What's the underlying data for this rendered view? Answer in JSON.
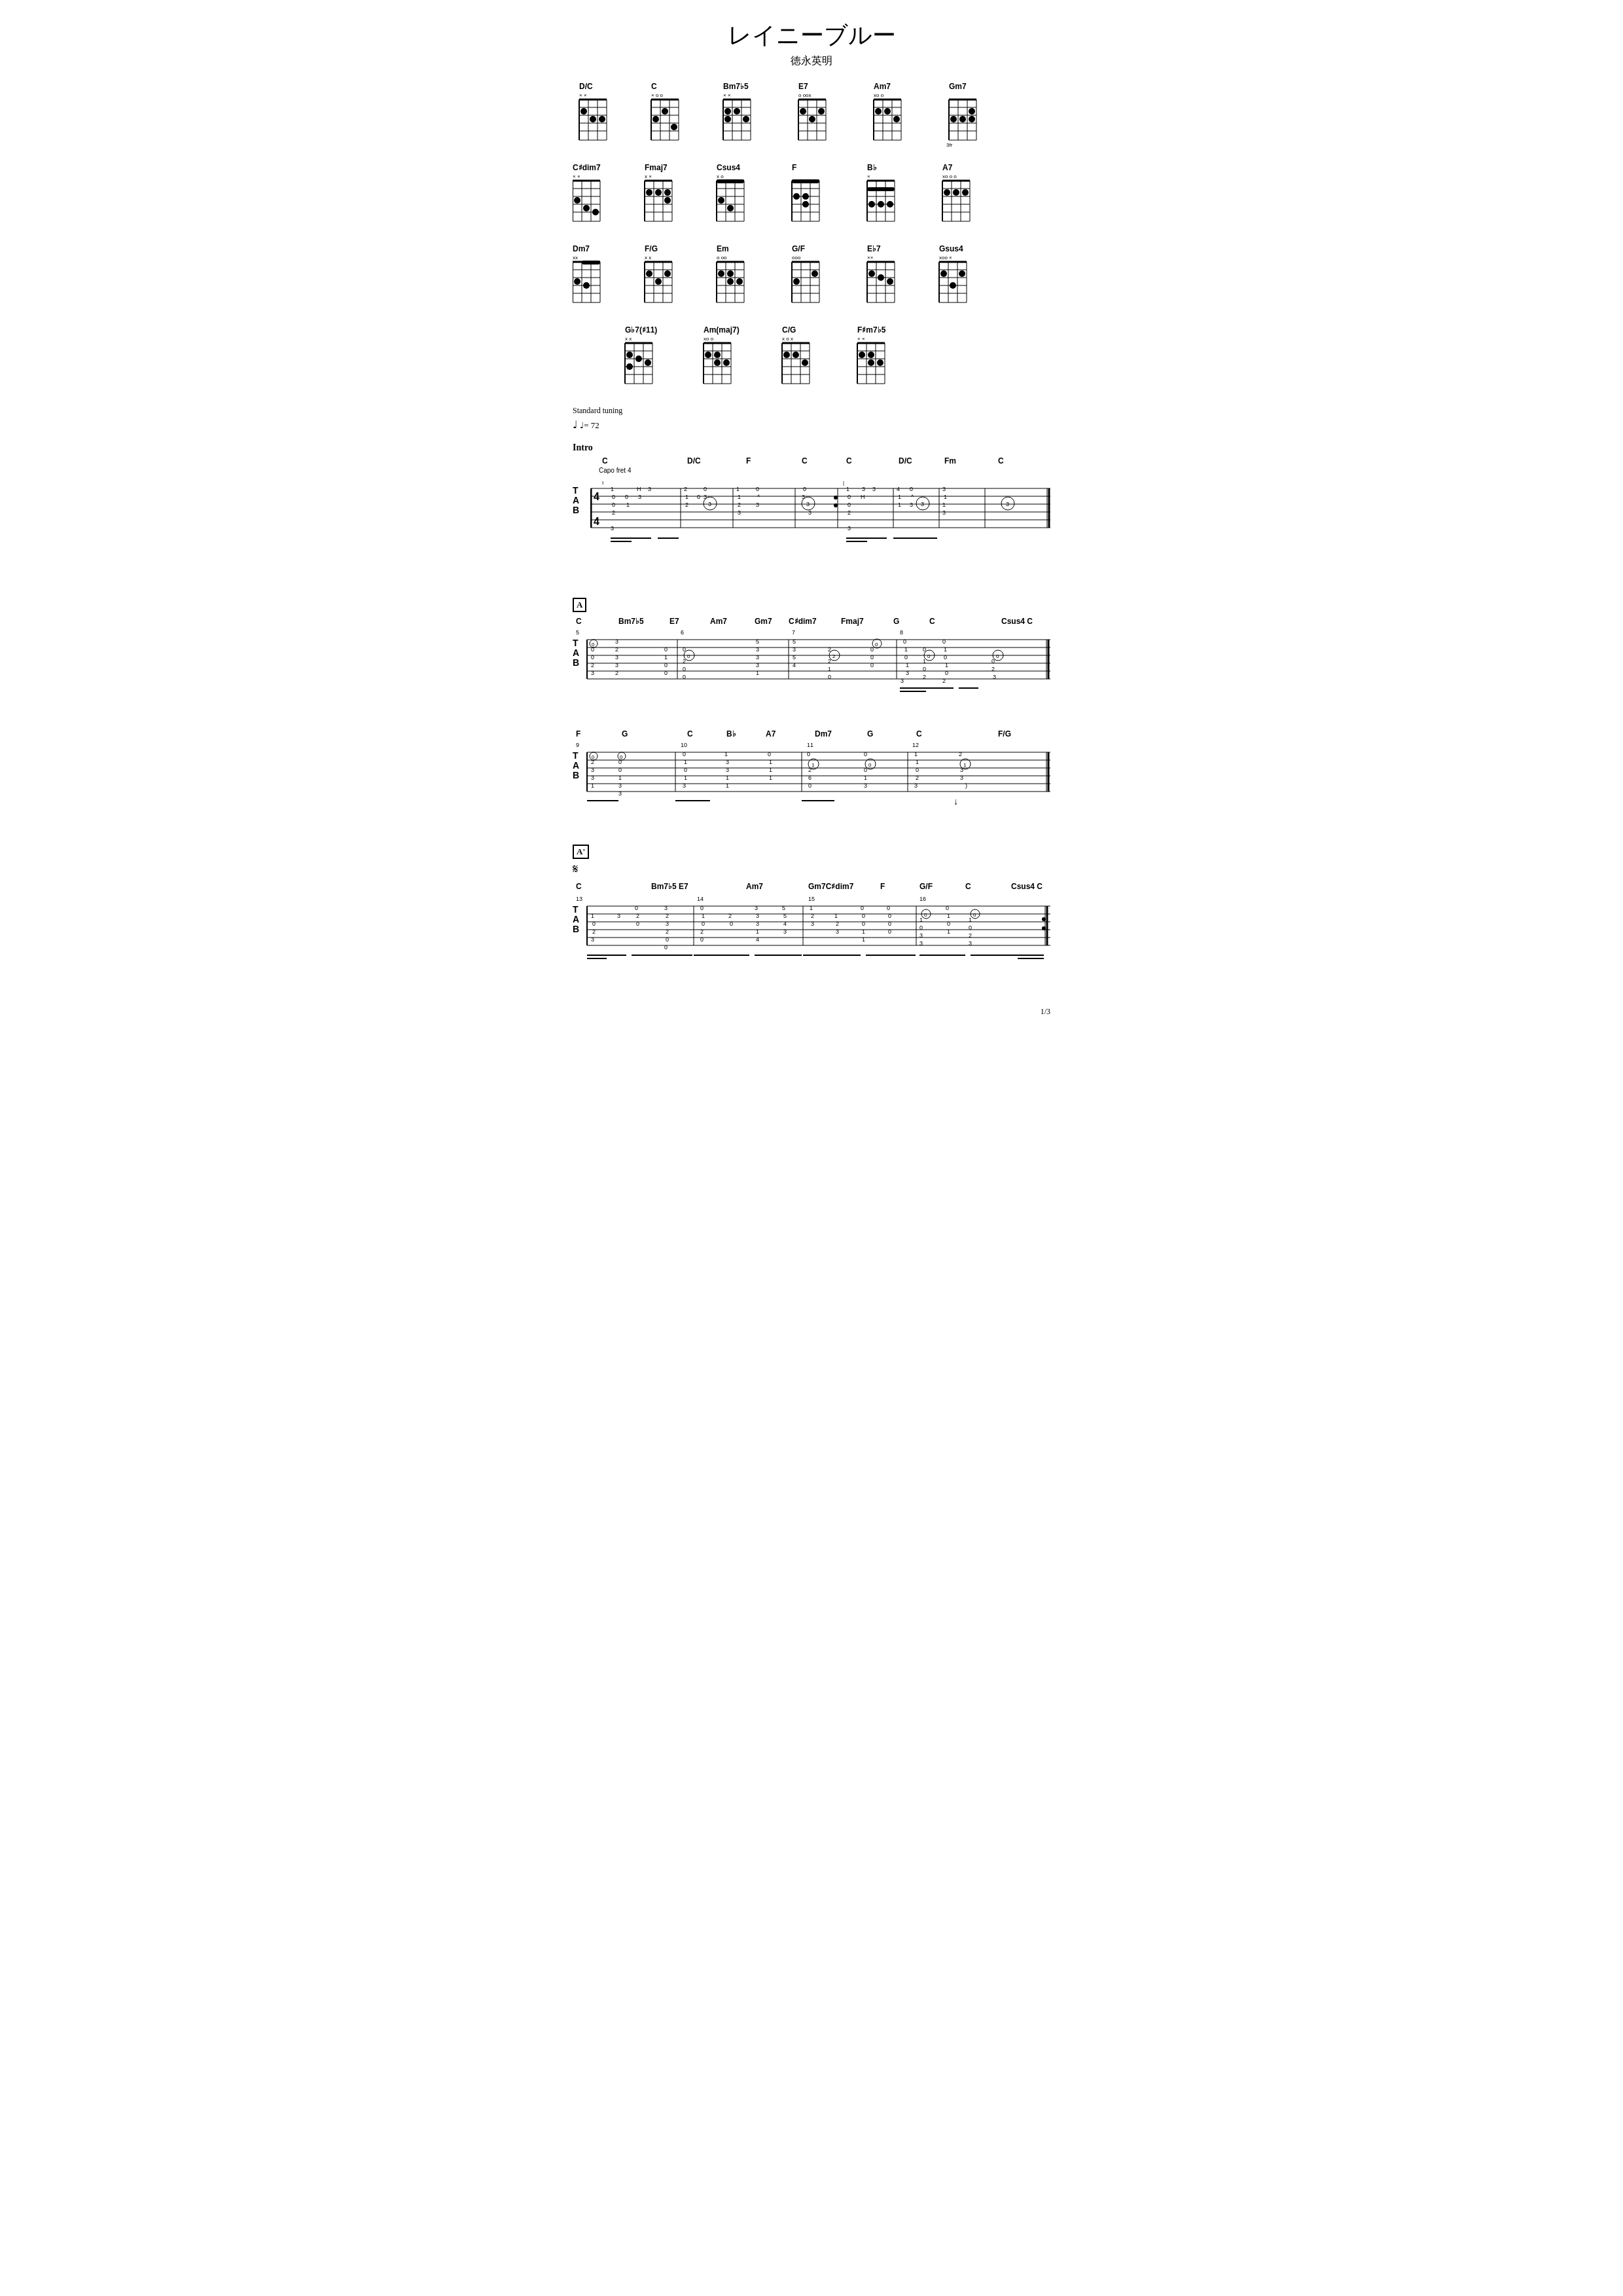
{
  "title": "レイニーブルー",
  "subtitle": "徳永英明",
  "tuning": "Standard tuning",
  "tempo": "♩= 72",
  "page_number": "1/3",
  "chord_rows": [
    [
      {
        "name": "D/C",
        "mutes": "x  x",
        "fret_indicator": null
      },
      {
        "name": "C",
        "mutes": "x oo",
        "fret_indicator": null
      },
      {
        "name": "Bm7♭5",
        "mutes": "x  x",
        "fret_indicator": null
      },
      {
        "name": "E7",
        "mutes": "o oox",
        "fret_indicator": null
      },
      {
        "name": "Am7",
        "mutes": "xo o",
        "fret_indicator": null
      },
      {
        "name": "Gm7",
        "mutes": "",
        "fret_indicator": null
      }
    ],
    [
      {
        "name": "C♯dim7",
        "mutes": "x  x",
        "fret_indicator": null
      },
      {
        "name": "Fmaj7",
        "mutes": "x x",
        "fret_indicator": null
      },
      {
        "name": "Csus4",
        "mutes": "x o",
        "fret_indicator": null
      },
      {
        "name": "F",
        "mutes": "",
        "fret_indicator": null
      },
      {
        "name": "B♭",
        "mutes": "x",
        "fret_indicator": null
      },
      {
        "name": "A7",
        "mutes": "xo o o",
        "fret_indicator": null
      }
    ],
    [
      {
        "name": "Dm7",
        "mutes": "xx",
        "fret_indicator": null
      },
      {
        "name": "F/G",
        "mutes": "x x",
        "fret_indicator": null
      },
      {
        "name": "Em",
        "mutes": "o oo",
        "fret_indicator": null
      },
      {
        "name": "G/F",
        "mutes": "ooo",
        "fret_indicator": null
      },
      {
        "name": "E♭7",
        "mutes": "xx",
        "fret_indicator": null
      },
      {
        "name": "Gsus4",
        "mutes": "xoo x",
        "fret_indicator": null
      }
    ],
    [
      {
        "name": "G♭7(♯11)",
        "mutes": "x x",
        "fret_indicator": null
      },
      {
        "name": "Am(maj7)",
        "mutes": "xo o",
        "fret_indicator": null
      },
      {
        "name": "C/G",
        "mutes": "x o x",
        "fret_indicator": null
      },
      {
        "name": "F♯m7♭5",
        "mutes": "x x",
        "fret_indicator": null
      }
    ]
  ],
  "sections": {
    "intro": {
      "label": "Intro",
      "capo": "Capo fret 4",
      "chords": [
        "C",
        "D/C",
        "F",
        "C",
        "C",
        "D/C",
        "Fm",
        "C"
      ]
    },
    "A": {
      "label": "A",
      "chords": [
        "C",
        "Bm7♭5",
        "E7",
        "Am7",
        "Gm7",
        "C♯dim7",
        "Fmaj7",
        "G",
        "C",
        "Csus4",
        "C"
      ]
    },
    "A2": {
      "label": "A",
      "chords": [
        "F",
        "G",
        "C",
        "B♭",
        "A7",
        "Dm7",
        "G",
        "C",
        "F/G"
      ]
    },
    "Aprime": {
      "label": "A'",
      "segno": true,
      "chords": [
        "C",
        "Bm7♭5",
        "E7",
        "Am7",
        "Gm7",
        "C♯dim7",
        "F",
        "G/F",
        "C",
        "Csus4",
        "C"
      ]
    }
  }
}
